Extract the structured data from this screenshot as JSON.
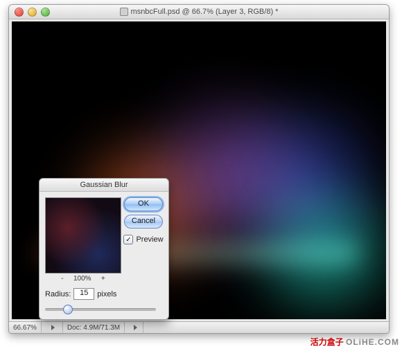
{
  "document": {
    "title_full": "msnbcFull.psd @ 66.7% (Layer 3, RGB/8) *"
  },
  "statusbar": {
    "zoom": "66.67%",
    "doc_info": "Doc: 4.9M/71.3M"
  },
  "dialog": {
    "title": "Gaussian Blur",
    "ok_label": "OK",
    "cancel_label": "Cancel",
    "preview_label": "Preview",
    "preview_checked": true,
    "zoom_minus": "-",
    "zoom_value": "100%",
    "zoom_plus": "+",
    "radius_label": "Radius:",
    "radius_value": "15",
    "radius_units": "pixels",
    "slider_pos_pct": 20
  },
  "watermark": {
    "red": "活力盒子",
    "gray": "OLiHE.COM"
  }
}
